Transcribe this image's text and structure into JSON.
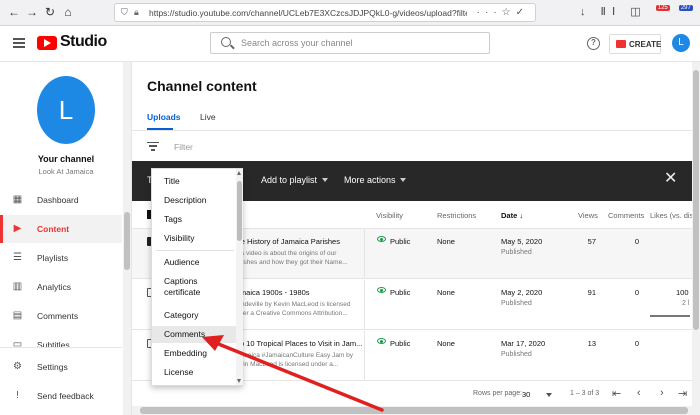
{
  "browser": {
    "url": "https://studio.youtube.com/channel/UCLeb7E3XCzcsJDJPQkL0-g/videos/upload?filter=[]&sort={\"column\":..."
  },
  "header": {
    "logo_text": "Studio",
    "search_placeholder": "Search across your channel",
    "create_label": "CREATE",
    "avatar_letter": "L"
  },
  "sidebar": {
    "avatar_letter": "L",
    "channel_name": "Your channel",
    "channel_sub": "Look At Jamaica",
    "items": [
      {
        "label": "Dashboard",
        "icon": "dashboard-icon"
      },
      {
        "label": "Content",
        "icon": "content-icon"
      },
      {
        "label": "Playlists",
        "icon": "playlists-icon"
      },
      {
        "label": "Analytics",
        "icon": "analytics-icon"
      },
      {
        "label": "Comments",
        "icon": "comments-icon"
      },
      {
        "label": "Subtitles",
        "icon": "subtitles-icon"
      },
      {
        "label": "Settings",
        "icon": "gear-icon"
      },
      {
        "label": "Send feedback",
        "icon": "feedback-icon"
      }
    ]
  },
  "main": {
    "title": "Channel content",
    "tabs": [
      "Uploads",
      "Live"
    ],
    "filter_placeholder": "Filter",
    "actions": {
      "add_to_playlist": "Add to playlist",
      "more_actions": "More actions",
      "t": "T"
    },
    "columns": {
      "visibility": "Visibility",
      "restrictions": "Restrictions",
      "date": "Date ↓",
      "views": "Views",
      "comments": "Comments",
      "likes": "Likes (vs. disli"
    },
    "rows": [
      {
        "title": "The History of Jamaica Parishes",
        "desc": "This video is about the origins of our Parishes and how they got their Name...",
        "visibility": "Public",
        "restrictions": "None",
        "date": "May 5, 2020",
        "status": "Published",
        "views": "57",
        "comments": "0",
        "likes": "",
        "likes_sub": ""
      },
      {
        "title": "Jamaica 1900s - 1980s",
        "desc": "Mandeville by Kevin MacLeod is licensed under a Creative Commons Attribution...",
        "visibility": "Public",
        "restrictions": "None",
        "date": "May 2, 2020",
        "status": "Published",
        "views": "91",
        "comments": "0",
        "likes": "100",
        "likes_sub": "2 l"
      },
      {
        "title": "Top 10 Tropical Places to Visit in Jam...",
        "desc": "#Jamaica #JamaicanCulture Easy Jam by Kevin MacLeod is licensed under a...",
        "visibility": "Public",
        "restrictions": "None",
        "date": "Mar 17, 2020",
        "status": "Published",
        "views": "13",
        "comments": "0",
        "likes": "",
        "likes_sub": ""
      }
    ],
    "footer": {
      "rows_per_page_label": "Rows per page:",
      "rows_per_page_value": "30",
      "range": "1 – 3 of 3"
    }
  },
  "dropdown": {
    "items": [
      "Title",
      "Description",
      "Tags",
      "Visibility",
      "Audience",
      "Captions certificate",
      "Category",
      "Comments",
      "Embedding",
      "License"
    ],
    "highlighted": "Comments"
  },
  "colors": {
    "accent": "#065fd4",
    "brand": "#ff0000",
    "annotation": "#e02020"
  }
}
